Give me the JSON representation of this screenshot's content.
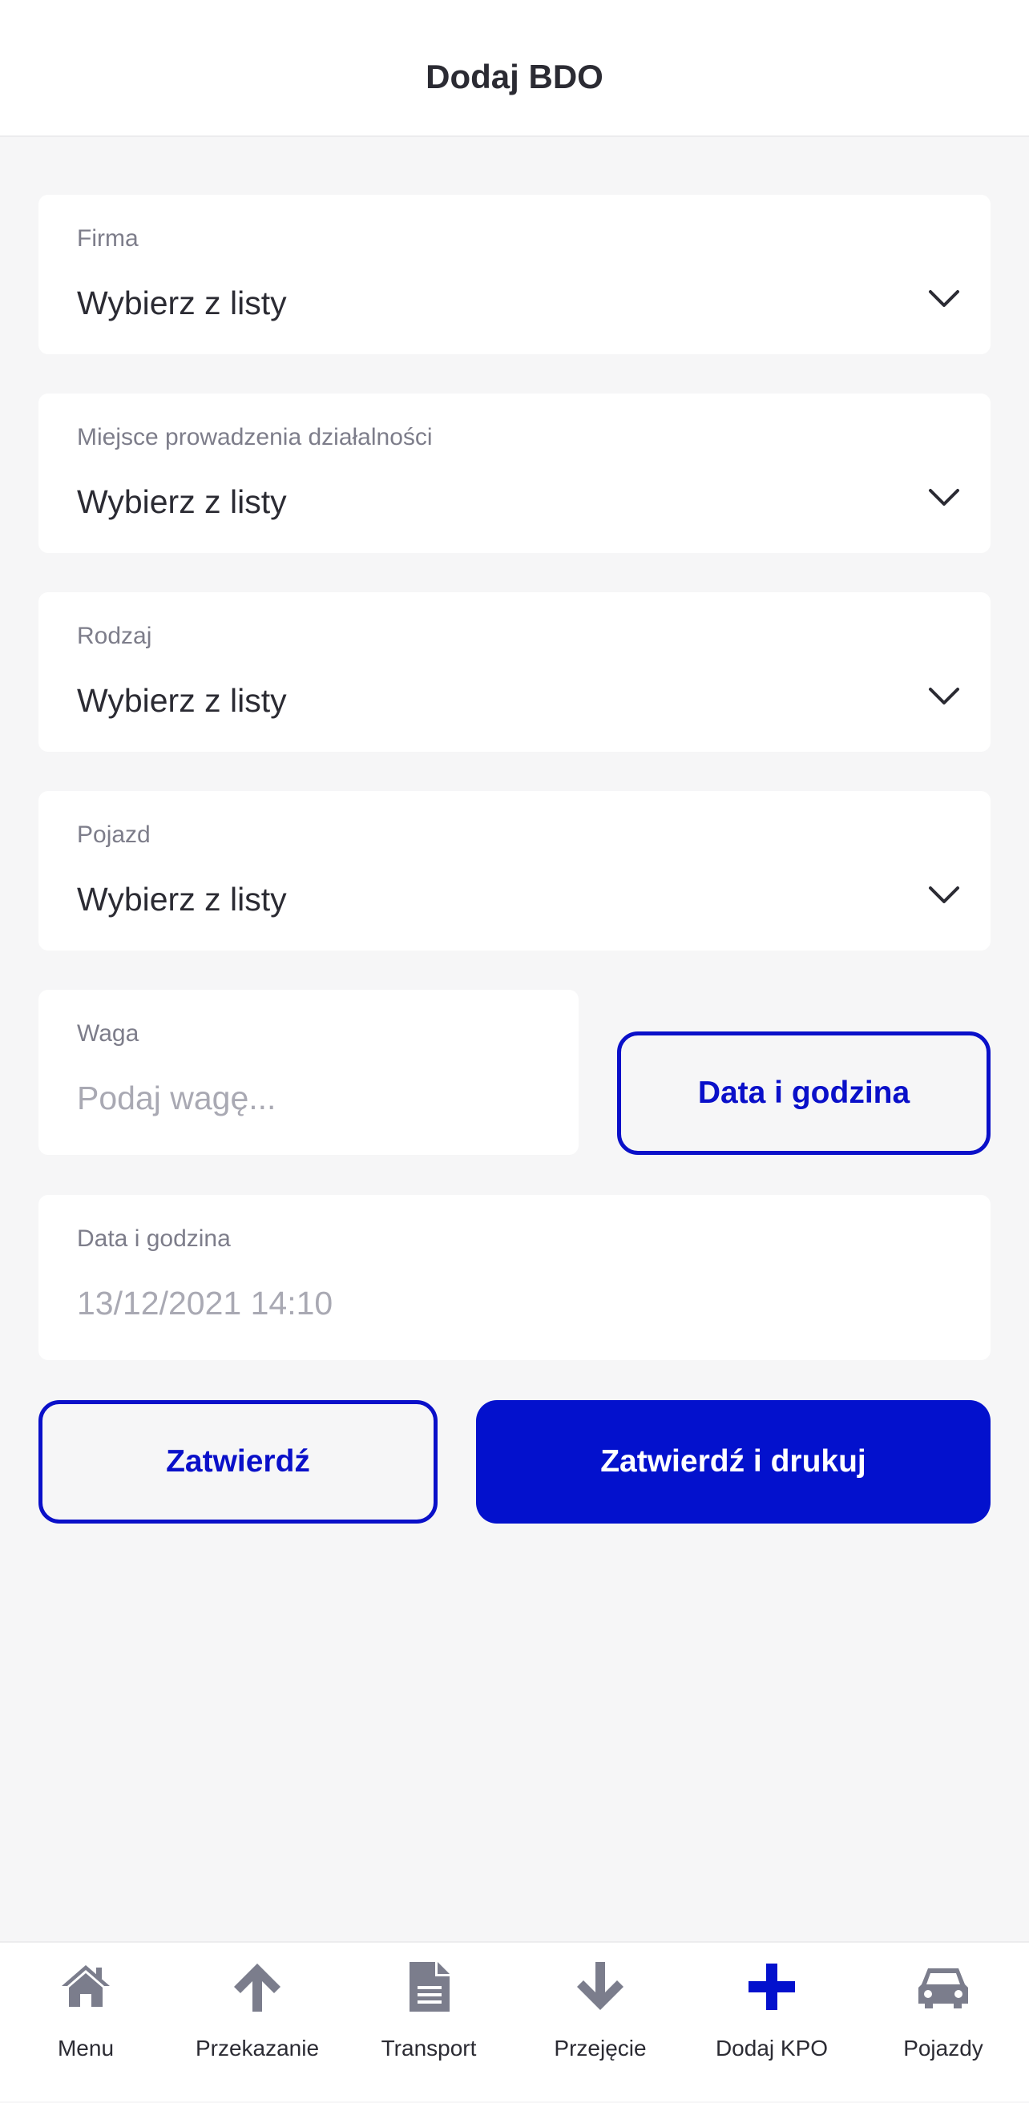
{
  "header": {
    "title": "Dodaj BDO"
  },
  "form": {
    "firma": {
      "label": "Firma",
      "value": "Wybierz z listy"
    },
    "miejsce": {
      "label": "Miejsce prowadzenia działalności",
      "value": "Wybierz z listy"
    },
    "rodzaj": {
      "label": "Rodzaj",
      "value": "Wybierz z listy"
    },
    "pojazd": {
      "label": "Pojazd",
      "value": "Wybierz z listy"
    },
    "waga": {
      "label": "Waga",
      "placeholder": "Podaj wagę..."
    },
    "date_button": "Data i godzina",
    "datetime": {
      "label": "Data i godzina",
      "value": "13/12/2021 14:10"
    }
  },
  "actions": {
    "confirm": "Zatwierdź",
    "confirm_print": "Zatwierdź i drukuj"
  },
  "tabbar": {
    "items": [
      {
        "label": "Menu",
        "icon": "home-icon"
      },
      {
        "label": "Przekazanie",
        "icon": "arrow-up-icon"
      },
      {
        "label": "Transport",
        "icon": "document-icon"
      },
      {
        "label": "Przejęcie",
        "icon": "arrow-down-icon"
      },
      {
        "label": "Dodaj KPO",
        "icon": "plus-icon",
        "active": true
      },
      {
        "label": "Pojazdy",
        "icon": "car-icon"
      }
    ]
  },
  "colors": {
    "accent": "#0311cd",
    "inactive_icon": "#7b7d8c",
    "background": "#f6f6f7"
  }
}
